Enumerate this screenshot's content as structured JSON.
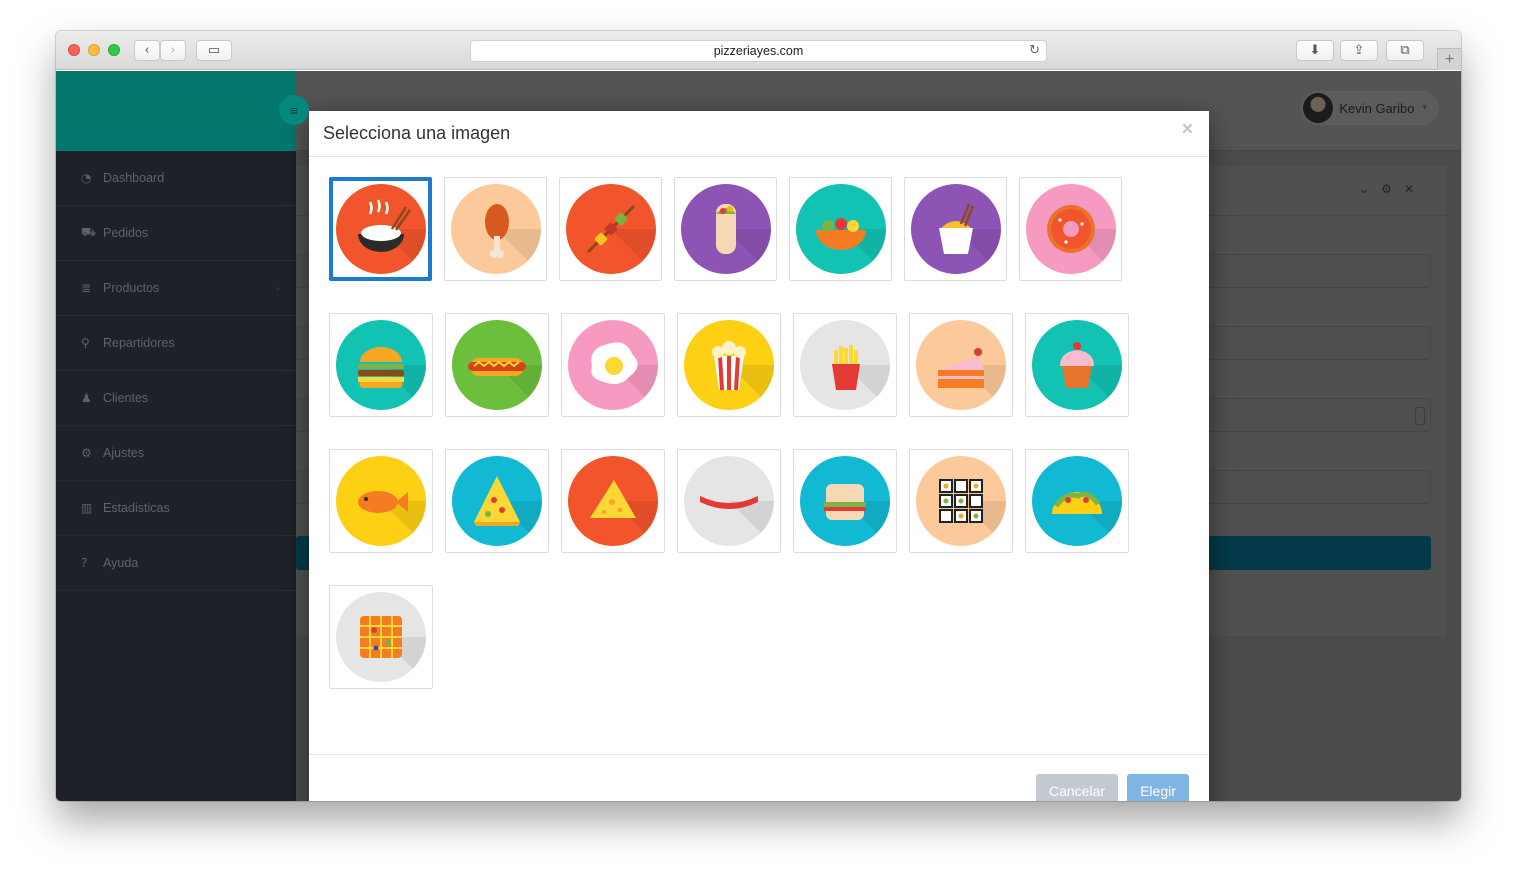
{
  "browser": {
    "url": "pizzeriayes.com",
    "back_icon": "‹",
    "forward_icon": "›",
    "sidebar_icon": "▭",
    "reload_icon": "↻",
    "download_icon": "⬇",
    "share_icon": "⇪",
    "tabs_icon": "⧉",
    "new_tab_icon": "+"
  },
  "app": {
    "menu_icon": "≡",
    "nav": [
      {
        "label": "Dashboard",
        "icon": "◔"
      },
      {
        "label": "Pedidos",
        "icon": "⛟"
      },
      {
        "label": "Productos",
        "icon": "≣",
        "chevron": "›"
      },
      {
        "label": "Repartidores",
        "icon": "⚲"
      },
      {
        "label": "Clientes",
        "icon": "♟"
      },
      {
        "label": "Ajustes",
        "icon": "⚙"
      },
      {
        "label": "Estadisticas",
        "icon": "▥"
      },
      {
        "label": "Ayuda",
        "icon": "?"
      }
    ],
    "user": {
      "name": "Kevin Garibo",
      "caret": "▾"
    },
    "panel_tools": "⌄⚙✕"
  },
  "modal": {
    "title": "Selecciona una imagen",
    "close": "×",
    "cancel_label": "Cancelar",
    "choose_label": "Elegir",
    "selected_index": 0,
    "images": [
      [
        "rice-bowl",
        "chicken-leg",
        "kebab-skewer",
        "burrito",
        "salad-bowl",
        "noodle-box",
        "donut"
      ],
      [
        "burger",
        "hot-dog",
        "fried-egg",
        "popcorn",
        "french-fries",
        "cake-slice",
        "cupcake"
      ],
      [
        "fish",
        "pizza-slice",
        "cheese",
        "sausage",
        "sandwich",
        "sushi-rolls",
        "taco"
      ],
      [
        "waffle"
      ]
    ]
  },
  "colors": {
    "teal": "#04776c",
    "sidebar": "#1e2127",
    "selected_border": "#1b7bd0",
    "choose_button": "#7fb5e2",
    "cancel_button": "#c3c9d0"
  }
}
